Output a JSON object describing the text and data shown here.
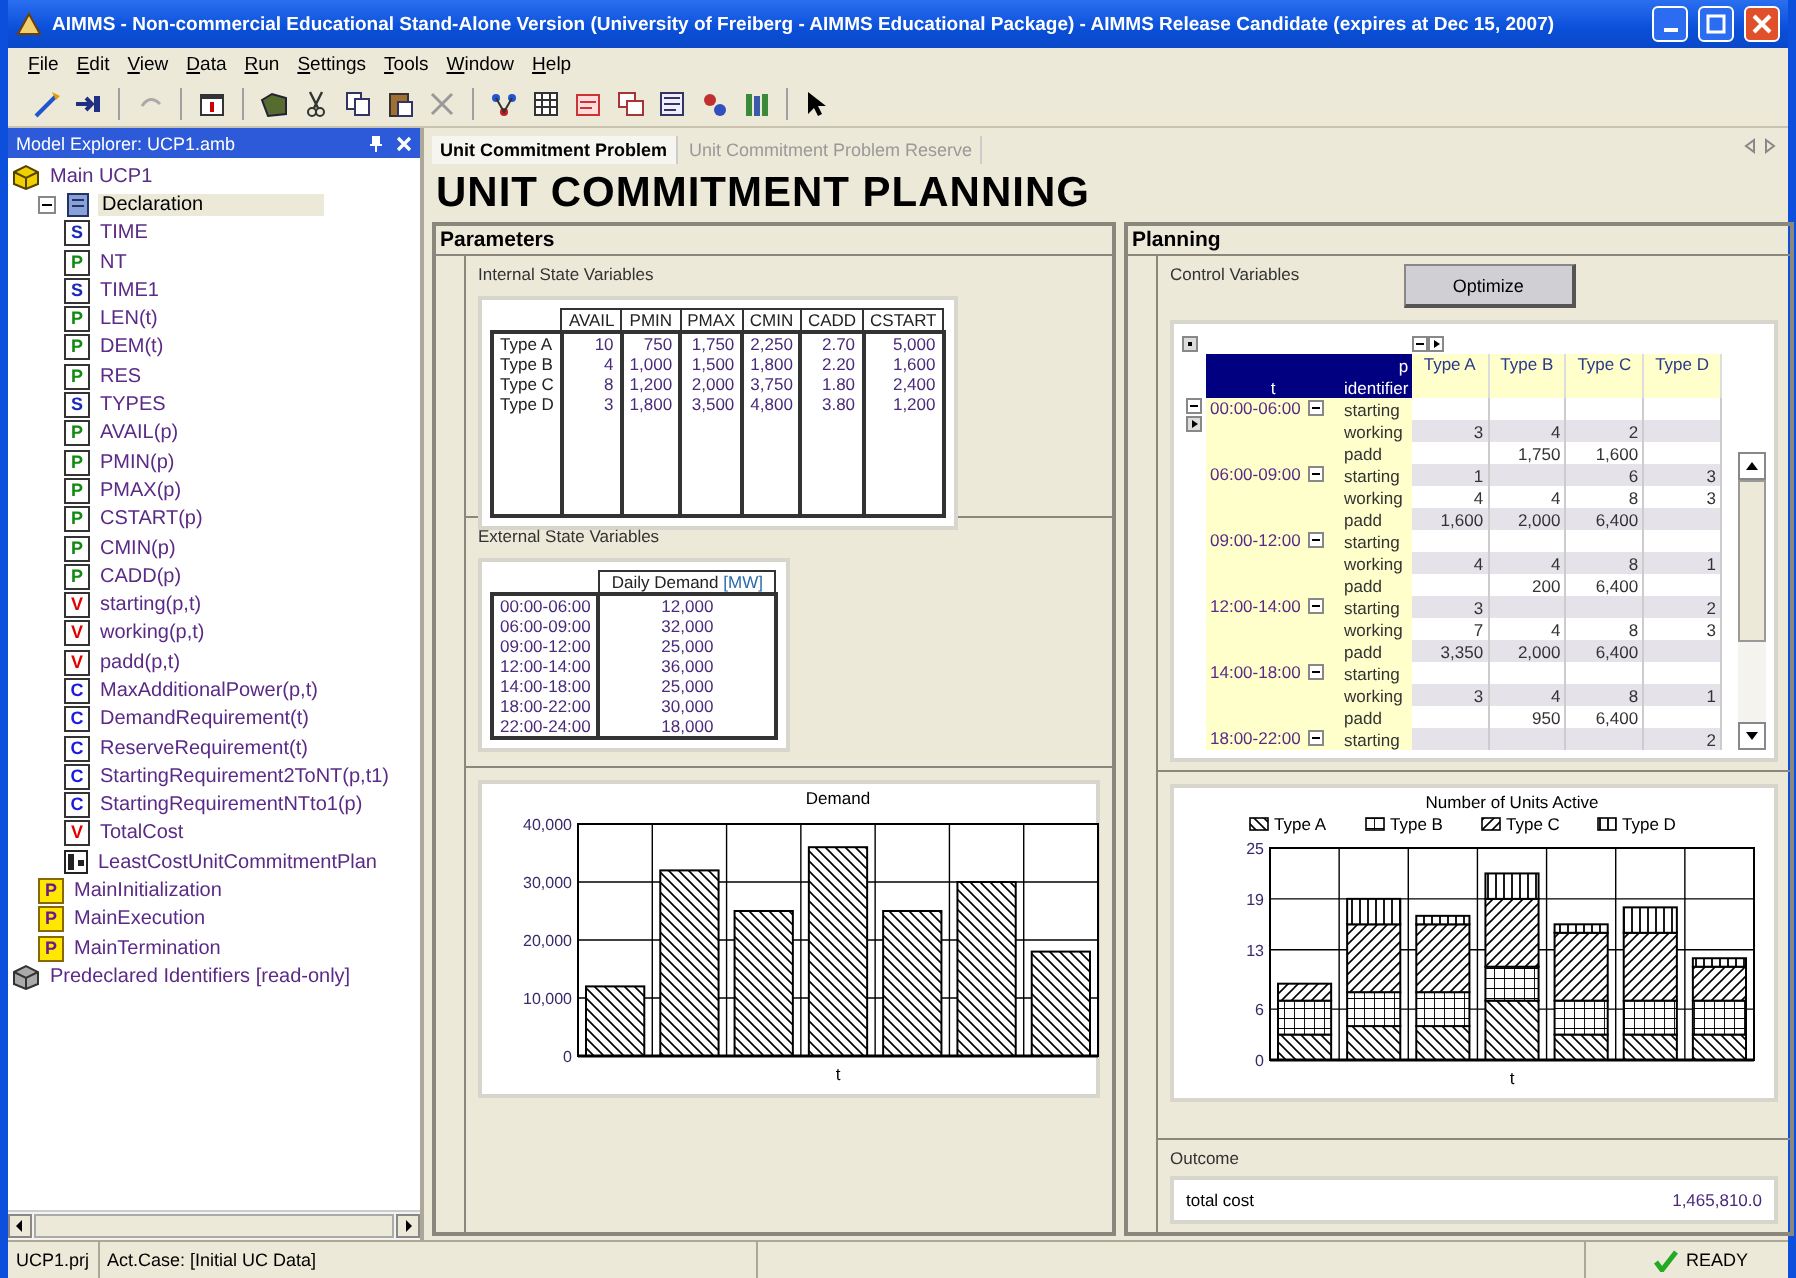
{
  "window": {
    "title": "AIMMS - Non-commercial Educational Stand-Alone Version (University of Freiberg - AIMMS Educational Package) - AIMMS Release Candidate (expires at Dec 15, 2007)"
  },
  "menu": [
    "File",
    "Edit",
    "View",
    "Data",
    "Run",
    "Settings",
    "Tools",
    "Window",
    "Help"
  ],
  "explorer": {
    "title": "Model Explorer: UCP1.amb",
    "tree": [
      {
        "label": "Main UCP1",
        "kind": "model",
        "selected": false,
        "children": [
          {
            "label": "Declaration",
            "kind": "section",
            "expanded": true,
            "selected": true,
            "children": [
              {
                "label": "TIME",
                "kind": "set",
                "tag": "S",
                "selected": false
              },
              {
                "label": "NT",
                "kind": "parameter",
                "tag": "P",
                "selected": false
              },
              {
                "label": "TIME1",
                "kind": "set",
                "tag": "S",
                "selected": false
              },
              {
                "label": "LEN(t)",
                "kind": "parameter",
                "tag": "P",
                "selected": false
              },
              {
                "label": "DEM(t)",
                "kind": "parameter",
                "tag": "P",
                "selected": false
              },
              {
                "label": "RES",
                "kind": "parameter",
                "tag": "P",
                "selected": false
              },
              {
                "label": "TYPES",
                "kind": "set",
                "tag": "S",
                "selected": false
              },
              {
                "label": "AVAIL(p)",
                "kind": "parameter",
                "tag": "P",
                "selected": false
              },
              {
                "label": "PMIN(p)",
                "kind": "parameter",
                "tag": "P",
                "selected": false
              },
              {
                "label": "PMAX(p)",
                "kind": "parameter",
                "tag": "P",
                "selected": false
              },
              {
                "label": "CSTART(p)",
                "kind": "parameter",
                "tag": "P",
                "selected": false
              },
              {
                "label": "CMIN(p)",
                "kind": "parameter",
                "tag": "P",
                "selected": false
              },
              {
                "label": "CADD(p)",
                "kind": "parameter",
                "tag": "P",
                "selected": false
              },
              {
                "label": "starting(p,t)",
                "kind": "variable",
                "tag": "V",
                "selected": false
              },
              {
                "label": "working(p,t)",
                "kind": "variable",
                "tag": "V",
                "selected": false
              },
              {
                "label": "padd(p,t)",
                "kind": "variable",
                "tag": "V",
                "selected": false
              },
              {
                "label": "MaxAdditionalPower(p,t)",
                "kind": "constraint",
                "tag": "C",
                "selected": false
              },
              {
                "label": "DemandRequirement(t)",
                "kind": "constraint",
                "tag": "C",
                "selected": false
              },
              {
                "label": "ReserveRequirement(t)",
                "kind": "constraint",
                "tag": "C",
                "selected": false
              },
              {
                "label": "StartingRequirement2ToNT(p,t1)",
                "kind": "constraint",
                "tag": "C",
                "selected": false
              },
              {
                "label": "StartingRequirementNTto1(p)",
                "kind": "constraint",
                "tag": "C",
                "selected": false
              },
              {
                "label": "TotalCost",
                "kind": "variable",
                "tag": "V",
                "selected": false
              },
              {
                "label": "LeastCostUnitCommitmentPlan",
                "kind": "mathprogram",
                "selected": false
              }
            ]
          },
          {
            "label": "MainInitialization",
            "kind": "procedure",
            "tag": "P",
            "selected": false
          },
          {
            "label": "MainExecution",
            "kind": "procedure",
            "tag": "P",
            "selected": false
          },
          {
            "label": "MainTermination",
            "kind": "procedure",
            "tag": "P",
            "selected": false
          }
        ]
      },
      {
        "label": "Predeclared Identifiers [read-only]",
        "kind": "library",
        "selected": false
      }
    ]
  },
  "tabs": [
    {
      "label": "Unit Commitment Problem",
      "selected": true
    },
    {
      "label": "Unit Commitment Problem Reserve",
      "selected": false
    }
  ],
  "page_title": "UNIT COMMITMENT PLANNING",
  "parameters": {
    "title": "Parameters",
    "internal": {
      "title": "Internal State Variables",
      "columns": [
        "AVAIL",
        "PMIN",
        "PMAX",
        "CMIN",
        "CADD",
        "CSTART"
      ],
      "rows": [
        {
          "label": "Type A",
          "values": [
            "10",
            "750",
            "1,750",
            "2,250",
            "2.70",
            "5,000"
          ]
        },
        {
          "label": "Type B",
          "values": [
            "4",
            "1,000",
            "1,500",
            "1,800",
            "2.20",
            "1,600"
          ]
        },
        {
          "label": "Type C",
          "values": [
            "8",
            "1,200",
            "2,000",
            "3,750",
            "1.80",
            "2,400"
          ]
        },
        {
          "label": "Type D",
          "values": [
            "3",
            "1,800",
            "3,500",
            "4,800",
            "3.80",
            "1,200"
          ]
        }
      ]
    },
    "external": {
      "title": "External State Variables",
      "column": "Daily Demand",
      "unit": "[MW]",
      "rows": [
        {
          "label": "00:00-06:00",
          "value": "12,000"
        },
        {
          "label": "06:00-09:00",
          "value": "32,000"
        },
        {
          "label": "09:00-12:00",
          "value": "25,000"
        },
        {
          "label": "12:00-14:00",
          "value": "36,000"
        },
        {
          "label": "14:00-18:00",
          "value": "25,000"
        },
        {
          "label": "18:00-22:00",
          "value": "30,000"
        },
        {
          "label": "22:00-24:00",
          "value": "18,000"
        }
      ]
    },
    "chart_data": {
      "type": "bar",
      "title": "Demand",
      "xlabel": "t",
      "grid": true,
      "values": [
        12000,
        32000,
        25000,
        36000,
        25000,
        30000,
        18000
      ],
      "ylim": [
        0,
        40000
      ],
      "yticks": [
        {
          "value": 0,
          "label": "0"
        },
        {
          "value": 10000,
          "label": "10,000"
        },
        {
          "value": 20000,
          "label": "20,000"
        },
        {
          "value": 30000,
          "label": "30,000"
        },
        {
          "value": 40000,
          "label": "40,000"
        }
      ]
    }
  },
  "planning": {
    "title": "Planning",
    "control_title": "Control Variables",
    "optimize_button": "Optimize",
    "pivot": {
      "column_index": "p",
      "row_header": "t",
      "identifier_header": "identifier",
      "columns": [
        "Type A",
        "Type B",
        "Type C",
        "Type D"
      ],
      "groups": [
        {
          "period": "00:00-06:00",
          "rows": [
            {
              "identifier": "starting"
            },
            {
              "identifier": "working",
              "values": {
                "type_a": "3",
                "type_b": "4",
                "type_c": "2"
              }
            },
            {
              "identifier": "padd",
              "values": {
                "type_b": "1,750",
                "type_c": "1,600"
              }
            }
          ]
        },
        {
          "period": "06:00-09:00",
          "rows": [
            {
              "identifier": "starting",
              "values": {
                "type_a": "1",
                "type_c": "6",
                "type_d": "3"
              }
            },
            {
              "identifier": "working",
              "values": {
                "type_a": "4",
                "type_b": "4",
                "type_c": "8",
                "type_d": "3"
              }
            },
            {
              "identifier": "padd",
              "values": {
                "type_a": "1,600",
                "type_b": "2,000",
                "type_c": "6,400"
              }
            }
          ]
        },
        {
          "period": "09:00-12:00",
          "rows": [
            {
              "identifier": "starting"
            },
            {
              "identifier": "working",
              "values": {
                "type_a": "4",
                "type_b": "4",
                "type_c": "8",
                "type_d": "1"
              }
            },
            {
              "identifier": "padd",
              "values": {
                "type_b": "200",
                "type_c": "6,400"
              }
            }
          ]
        },
        {
          "period": "12:00-14:00",
          "rows": [
            {
              "identifier": "starting",
              "values": {
                "type_a": "3",
                "type_d": "2"
              }
            },
            {
              "identifier": "working",
              "values": {
                "type_a": "7",
                "type_b": "4",
                "type_c": "8",
                "type_d": "3"
              }
            },
            {
              "identifier": "padd",
              "values": {
                "type_a": "3,350",
                "type_b": "2,000",
                "type_c": "6,400"
              }
            }
          ]
        },
        {
          "period": "14:00-18:00",
          "rows": [
            {
              "identifier": "starting"
            },
            {
              "identifier": "working",
              "values": {
                "type_a": "3",
                "type_b": "4",
                "type_c": "8",
                "type_d": "1"
              }
            },
            {
              "identifier": "padd",
              "values": {
                "type_b": "950",
                "type_c": "6,400"
              }
            }
          ]
        },
        {
          "period": "18:00-22:00",
          "rows": [
            {
              "identifier": "starting",
              "values": {
                "type_d": "2"
              }
            }
          ]
        }
      ]
    },
    "chart_data": {
      "type": "bar",
      "title": "Number of Units Active",
      "xlabel": "t",
      "stacked": true,
      "grid": true,
      "legend": "top",
      "series": [
        {
          "name": "Type A",
          "values": [
            3,
            4,
            4,
            7,
            3,
            3,
            3
          ]
        },
        {
          "name": "Type B",
          "values": [
            4,
            4,
            4,
            4,
            4,
            4,
            4
          ]
        },
        {
          "name": "Type C",
          "values": [
            2,
            8,
            8,
            8,
            8,
            8,
            4
          ]
        },
        {
          "name": "Type D",
          "values": [
            0,
            3,
            1,
            3,
            1,
            3,
            1
          ]
        }
      ],
      "ylim": [
        0,
        25
      ],
      "yticks": [
        0,
        6,
        13,
        19,
        25
      ]
    },
    "outcome": {
      "title": "Outcome",
      "label": "total cost",
      "value": "1,465,810.0"
    }
  },
  "status_bar": {
    "project": "UCP1.prj",
    "case": "Act.Case: [Initial UC Data]",
    "state": "READY"
  }
}
